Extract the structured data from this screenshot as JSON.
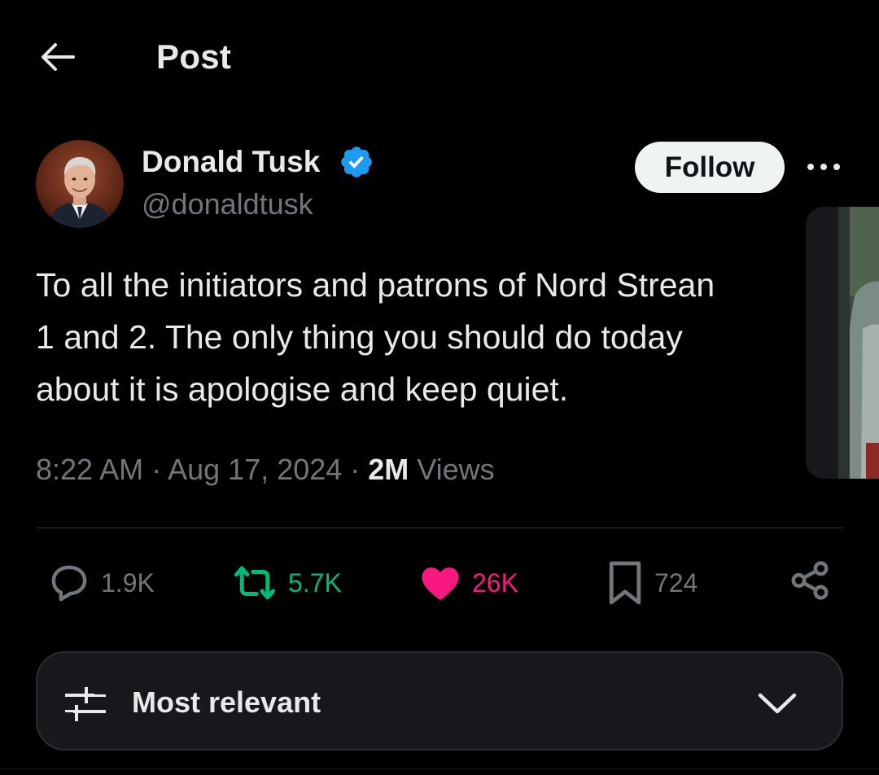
{
  "header": {
    "title": "Post",
    "back_icon": "arrow-left-icon"
  },
  "post": {
    "author": {
      "name": "Donald Tusk",
      "handle": "@donaldtusk",
      "verified": true
    },
    "follow_label": "Follow",
    "text": "To all the initiators and patrons of Nord Strean\n1 and 2. The only thing you should do today\nabout it is apologise and keep quiet.",
    "timestamp": "8:22 AM · Aug 17, 2024 · ",
    "views_count": "2M",
    "views_label": " Views"
  },
  "actions": {
    "replies": "1.9K",
    "reposts": "5.7K",
    "likes": "26K",
    "bookmarks": "724"
  },
  "sort": {
    "label": "Most relevant"
  },
  "colors": {
    "background": "#000000",
    "text": "#e7e9ea",
    "secondary": "#71767b",
    "verified": "#1d9bf0",
    "repost": "#00ba7c",
    "like": "#f91880",
    "follow_bg": "#eff3f4"
  }
}
